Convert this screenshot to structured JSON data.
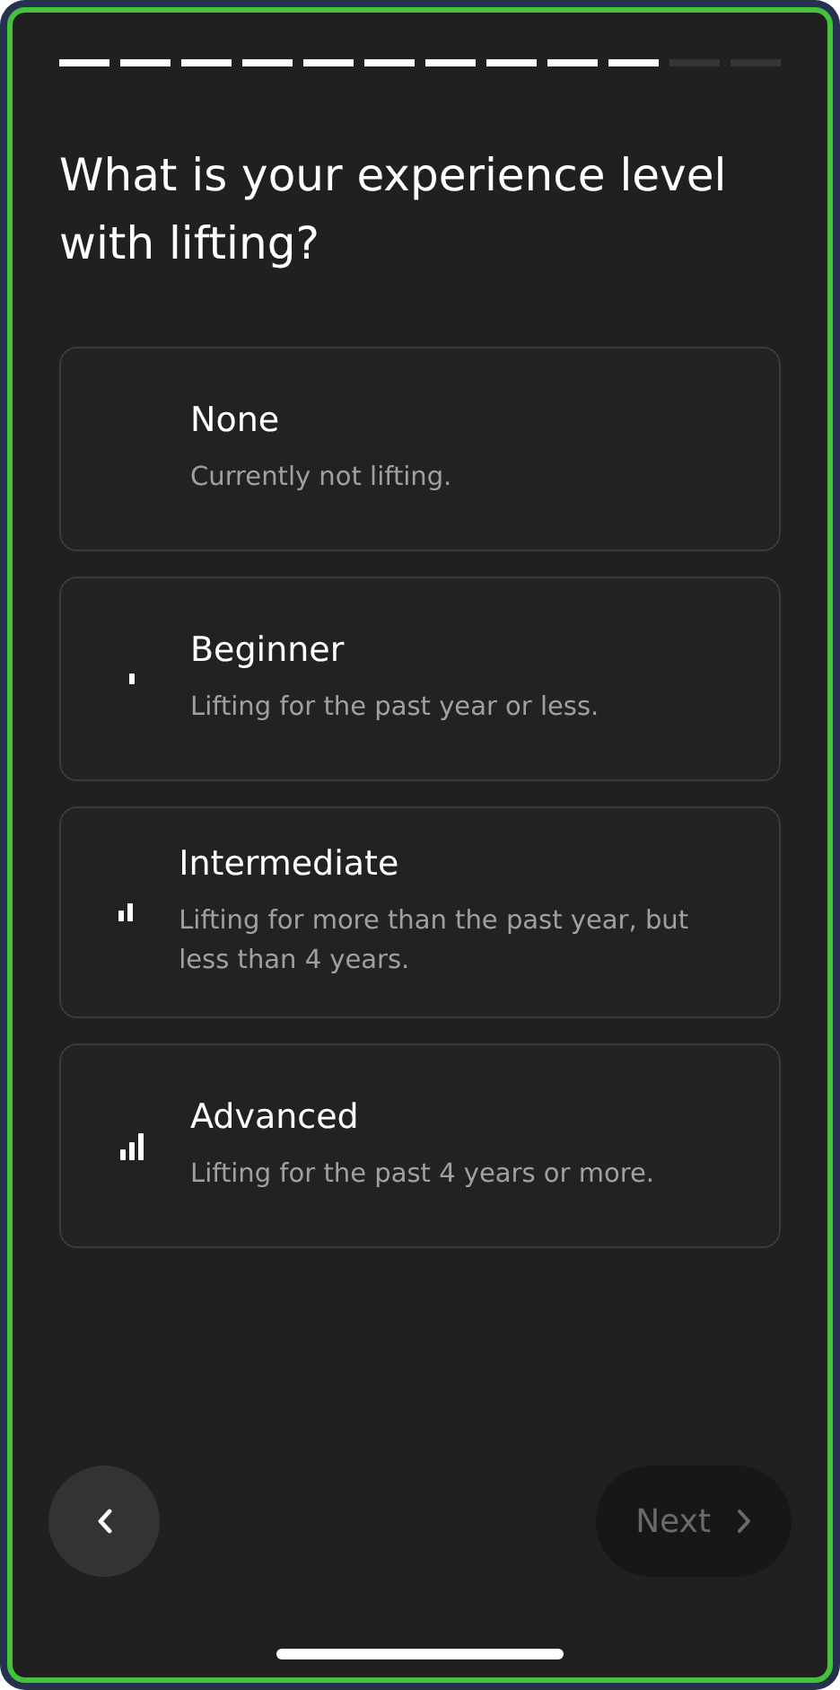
{
  "progress": {
    "steps": [
      {
        "completed": true
      },
      {
        "completed": true
      },
      {
        "completed": true
      },
      {
        "completed": true
      },
      {
        "completed": true
      },
      {
        "completed": true
      },
      {
        "completed": true
      },
      {
        "completed": true
      },
      {
        "completed": true
      },
      {
        "completed": true
      },
      {
        "completed": false
      },
      {
        "completed": false
      }
    ]
  },
  "question": "What is your experience level with lifting?",
  "options": [
    {
      "kind": "no-bars",
      "title": "None",
      "description": "Currently not lifting.",
      "selected": false
    },
    {
      "kind": "one-bar",
      "title": "Beginner",
      "description": "Lifting for the past year or less.",
      "selected": false
    },
    {
      "kind": "two-bars",
      "title": "Intermediate",
      "description": "Lifting for more than the past year, but less than 4 years.",
      "selected": false
    },
    {
      "kind": "three-bars",
      "title": "Advanced",
      "description": "Lifting for the past 4 years or more.",
      "selected": false
    }
  ],
  "navigation": {
    "next": {
      "label": "Next",
      "disabled": true
    }
  }
}
